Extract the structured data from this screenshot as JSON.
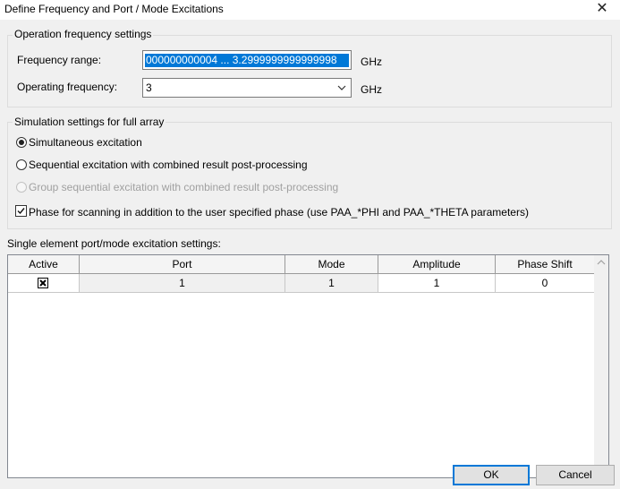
{
  "window": {
    "title": "Define Frequency and Port / Mode Excitations",
    "close_symbol": "✕"
  },
  "operation": {
    "group_label": "Operation frequency settings",
    "frequency_range_label": "Frequency range:",
    "frequency_range_value": "000000000004 ... 3.2999999999999998",
    "frequency_range_unit": "GHz",
    "operating_frequency_label": "Operating frequency:",
    "operating_frequency_value": "3",
    "operating_frequency_unit": "GHz"
  },
  "simulation": {
    "group_label": "Simulation settings for full array",
    "options": [
      {
        "label": "Simultaneous excitation",
        "checked": true,
        "enabled": true
      },
      {
        "label": "Sequential excitation with combined result post-processing",
        "checked": false,
        "enabled": true
      },
      {
        "label": "Group sequential excitation with combined result post-processing",
        "checked": false,
        "enabled": false
      }
    ],
    "phase_scanning_label": "Phase for scanning in addition to the user specified phase (use PAA_*PHI and PAA_*THETA parameters)",
    "phase_scanning_checked": true
  },
  "ports": {
    "section_label": "Single element port/mode excitation settings:",
    "columns": [
      "Active",
      "Port",
      "Mode",
      "Amplitude",
      "Phase Shift"
    ],
    "rows": [
      {
        "active": true,
        "port": "1",
        "mode": "1",
        "amplitude": "1",
        "phase_shift": "0"
      }
    ]
  },
  "buttons": {
    "ok_label": "OK",
    "cancel_label": "Cancel"
  },
  "icons": {
    "close": "close-icon",
    "dropdown": "chevron-down-icon",
    "checkmark": "checkmark-icon",
    "scroll_up": "scroll-up-arrow-icon",
    "scroll_down": "scroll-down-arrow-icon"
  }
}
